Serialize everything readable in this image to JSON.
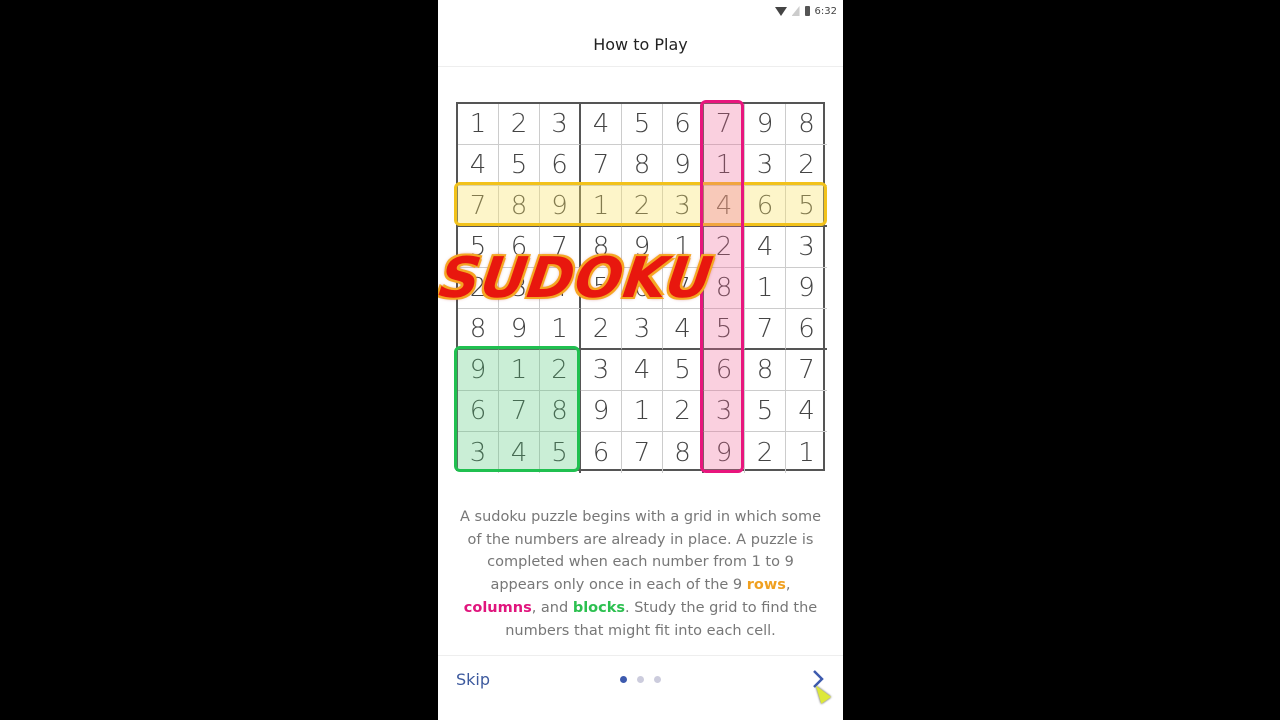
{
  "statusbar": {
    "time": "6:32",
    "icons": [
      "wifi-icon",
      "no-sim-icon",
      "battery-icon"
    ]
  },
  "header": {
    "title": "How to Play"
  },
  "grid": [
    [
      1,
      2,
      3,
      4,
      5,
      6,
      7,
      9,
      8
    ],
    [
      4,
      5,
      6,
      7,
      8,
      9,
      1,
      3,
      2
    ],
    [
      7,
      8,
      9,
      1,
      2,
      3,
      4,
      6,
      5
    ],
    [
      5,
      6,
      7,
      8,
      9,
      1,
      2,
      4,
      3
    ],
    [
      2,
      3,
      4,
      5,
      6,
      7,
      8,
      1,
      9
    ],
    [
      8,
      9,
      1,
      2,
      3,
      4,
      5,
      7,
      6
    ],
    [
      9,
      1,
      2,
      3,
      4,
      5,
      6,
      8,
      7
    ],
    [
      6,
      7,
      8,
      9,
      1,
      2,
      3,
      5,
      4
    ],
    [
      3,
      4,
      5,
      6,
      7,
      8,
      9,
      2,
      1
    ]
  ],
  "highlights": {
    "row": {
      "index": 3,
      "color": "#f2c21b"
    },
    "column": {
      "index": 7,
      "color": "#e8157d"
    },
    "block": {
      "index": 7,
      "color": "#20c050"
    }
  },
  "overlay": {
    "logo_text": "SUDOKU"
  },
  "description": {
    "part1": "A sudoku puzzle begins with a grid in which some of the numbers are already in place. A puzzle is completed when each number from 1 to 9 appears only once in each of the 9 ",
    "rows": "rows",
    "sep1": ", ",
    "columns": "columns",
    "sep2": ", and ",
    "blocks": "blocks",
    "part2": ". Study the grid to find the numbers that might fit into each cell."
  },
  "footer": {
    "skip_label": "Skip",
    "pages_total": 3,
    "current_page": 1,
    "next_icon": "chevron-right-icon"
  }
}
